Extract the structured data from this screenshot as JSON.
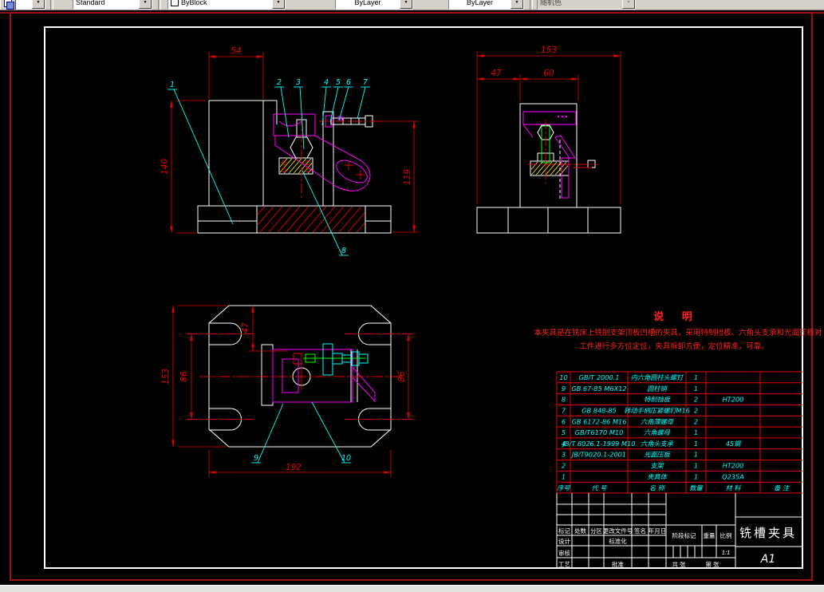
{
  "toolbar": {
    "combos": {
      "style": "Standard",
      "color": "ByBlock",
      "linetype": "ByLayer",
      "lineweight": "ByLayer",
      "plot_style": "随机色"
    }
  },
  "views": {
    "front": {
      "dim_width_top": "54",
      "dim_height_left": "140",
      "dim_height_right": "119",
      "leaders": [
        "1",
        "2",
        "3",
        "4",
        "5",
        "6",
        "7",
        "8"
      ]
    },
    "side": {
      "dim_width_top": "153",
      "dim_left": "47",
      "dim_right": "60"
    },
    "top": {
      "dim_height_outer": "153",
      "dim_height_inner": "86",
      "dim_depth": "47",
      "dim_height_right": "86",
      "dim_width_bottom": "192",
      "leaders": [
        "9",
        "10"
      ]
    }
  },
  "notes": {
    "title": "说  明",
    "lines": [
      "本夹具是在铣床上铣削支架顶板凹槽的夹具，采用特制挡板、六角头支承和光面压板对",
      "工件进行多方位定位，夹具拆卸方便，定位精准，可靠。"
    ]
  },
  "bom": {
    "headers": [
      "序号",
      "代  号",
      "名  称",
      "数量",
      "材  料",
      "备  注"
    ],
    "rows": [
      [
        "10",
        "GB/T 2000.1",
        "内六角圆柱头螺钉",
        "1",
        "",
        ""
      ],
      [
        "9",
        "GB 67-85  M6X12",
        "圆柱销",
        "1",
        "",
        ""
      ],
      [
        "8",
        "",
        "特制挡板",
        "2",
        "HT200",
        ""
      ],
      [
        "7",
        "GB 848-85",
        "转动手柄压紧螺钉M16",
        "2",
        "",
        ""
      ],
      [
        "6",
        "GB 6172-86  M16",
        "六角薄螺母",
        "2",
        "",
        ""
      ],
      [
        "5",
        "GB/T6170  M10",
        "六角螺母",
        "1",
        "",
        ""
      ],
      [
        "4",
        "JB/T 8026.1-1999 M10",
        "六角头支承",
        "1",
        "45钢",
        ""
      ],
      [
        "3",
        "JB/T9020.1-2001",
        "光面压板",
        "1",
        "",
        ""
      ],
      [
        "2",
        "",
        "支架",
        "1",
        "HT200",
        ""
      ],
      [
        "1",
        "",
        "夹具体",
        "1",
        "Q235A",
        ""
      ]
    ]
  },
  "title_block": {
    "revision_headers": [
      "标记",
      "处数",
      "分区",
      "更改文件号",
      "签名",
      "年月日"
    ],
    "roles": {
      "design": "设计",
      "standardization": "标准化",
      "review": "审核",
      "process": "工艺",
      "approve": "批准"
    },
    "stage_label": "阶段标记",
    "weight_label": "重量",
    "scale_label": "比例",
    "scale_value": "1:1",
    "sheet_total_label": "共  张",
    "sheet_no_label": "第  张",
    "drawing_title": "铣槽夹具",
    "sheet_size": "A1"
  },
  "colors": {
    "outline": "#ffffff",
    "dimension": "#e80000",
    "leader": "#00ffff",
    "clamp": "#ff00ff",
    "screw": "#00ff00",
    "hatch_block": "#ffff00",
    "toolbar_bg": "#d4d0c8"
  }
}
